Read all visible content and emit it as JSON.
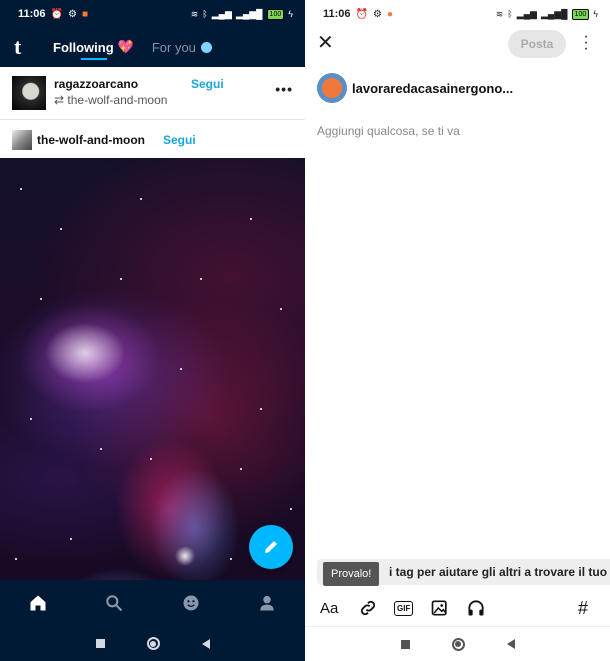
{
  "left": {
    "status": {
      "time": "11:06",
      "battery": "100"
    },
    "header": {
      "logo": "t",
      "tabs": [
        {
          "label": "Following",
          "active": true
        },
        {
          "label": "For you",
          "active": false
        }
      ]
    },
    "post": {
      "username": "ragazzoarcano",
      "follow_label": "Segui",
      "reblogged_from": "the-wolf-and-moon",
      "more": "•••"
    },
    "post2": {
      "username": "the-wolf-and-moon",
      "follow_label": "Segui"
    },
    "bottom_nav": [
      "home-icon",
      "search-icon",
      "activity-icon",
      "account-icon"
    ]
  },
  "right": {
    "status": {
      "time": "11:06",
      "battery": "100"
    },
    "close": "✕",
    "post_button": "Posta",
    "blog_name": "lavoraredacasainergono...",
    "placeholder": "Aggiungi qualcosa, se ti va",
    "tooltip": "Provalo!",
    "tag_hint": "i tag per aiutare gli altri a trovare il tuo",
    "toolbar": {
      "text_format": "Aa",
      "gif": "GIF",
      "hashtag": "#"
    }
  },
  "colors": {
    "tumblr_navy": "#001935",
    "accent_blue": "#00b8ff",
    "follow_blue": "#19a5d8"
  }
}
